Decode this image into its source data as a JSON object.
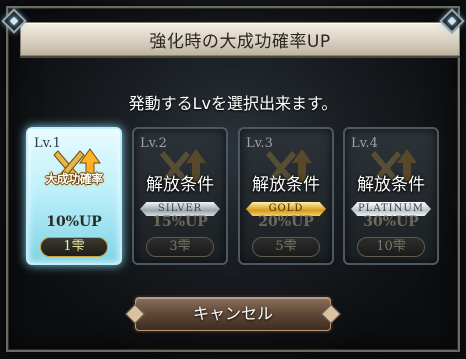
{
  "dialog": {
    "title": "強化時の大成功確率UP",
    "subtitle": "発動するLvを選択出来ます。"
  },
  "levels": [
    {
      "level": "Lv.1",
      "active_label": "大成功確率",
      "locked_label": "",
      "rank": "",
      "rate": "10%UP",
      "cost": "1雫"
    },
    {
      "level": "Lv.2",
      "active_label": "",
      "locked_label": "解放条件",
      "rank": "SILVER",
      "rate": "15%UP",
      "cost": "3雫"
    },
    {
      "level": "Lv.3",
      "active_label": "",
      "locked_label": "解放条件",
      "rank": "GOLD",
      "rate": "20%UP",
      "cost": "5雫"
    },
    {
      "level": "Lv.4",
      "active_label": "",
      "locked_label": "解放条件",
      "rank": "PLATINUM",
      "rate": "30%UP",
      "cost": "10雫"
    }
  ],
  "cancel_label": "キャンセル",
  "icons": {
    "emblem": "crossed-swords-up-arrow-icon",
    "corner": "diamond-gem-icon"
  },
  "colors": {
    "active_card": "#bff0fa",
    "title_bg": "#e6dfd0",
    "cancel_button": "#5e4737"
  }
}
